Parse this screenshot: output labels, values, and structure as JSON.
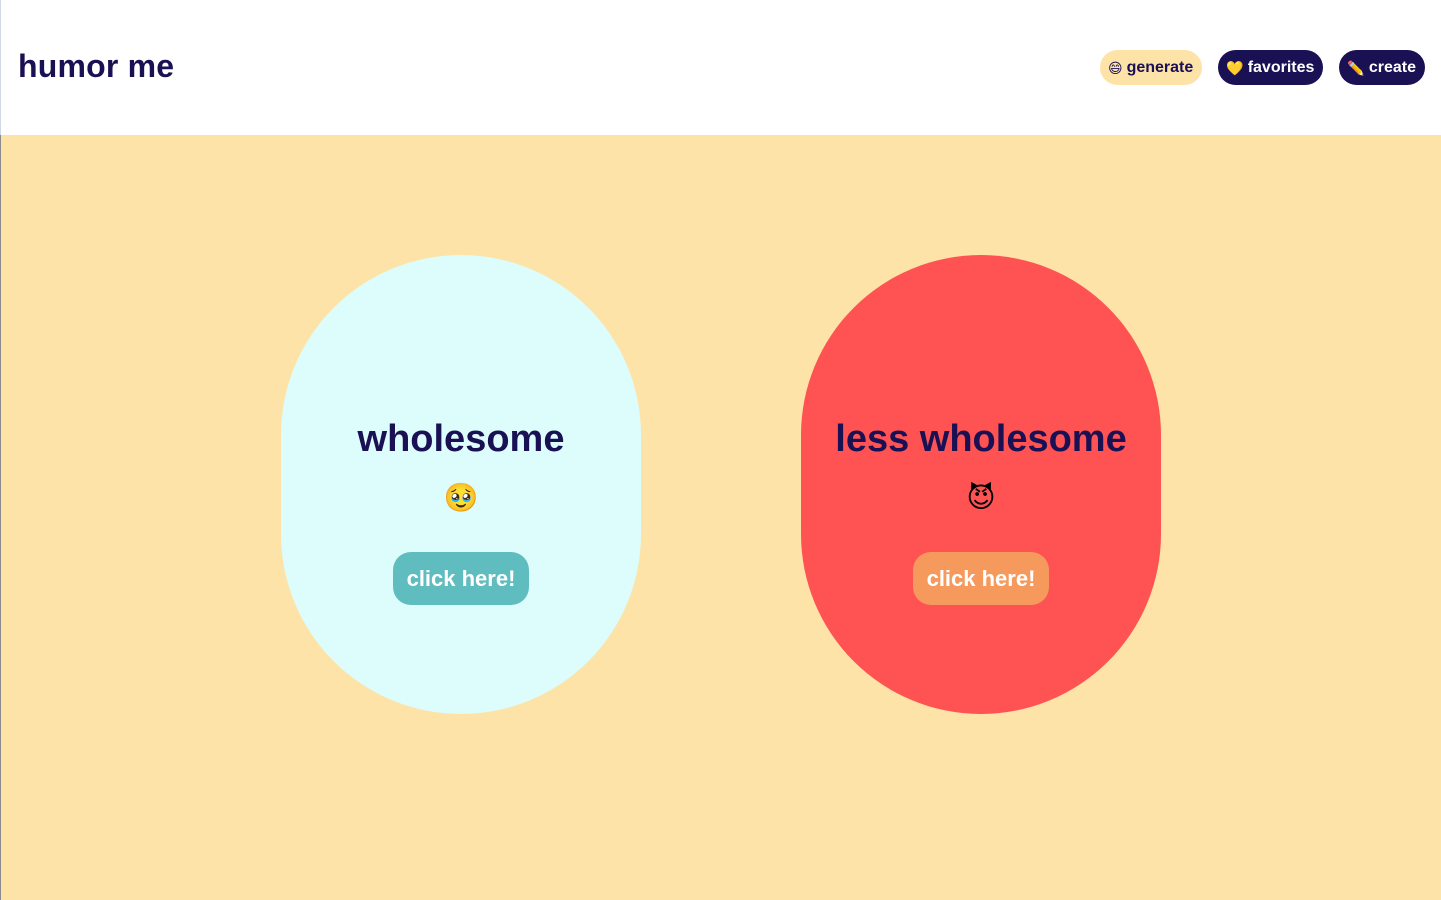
{
  "header": {
    "brand": "humor me",
    "nav": [
      {
        "icon": "😄",
        "icon_name": "grinning-face-icon",
        "label": "generate",
        "active": true
      },
      {
        "icon": "💛",
        "icon_name": "yellow-heart-icon",
        "label": "favorites",
        "active": false
      },
      {
        "icon": "✏️",
        "icon_name": "pencil-icon",
        "label": "create",
        "active": false
      }
    ]
  },
  "cards": [
    {
      "title": "wholesome",
      "emoji": "🥹",
      "emoji_name": "holding-back-tears-face-icon",
      "button_label": "click here!",
      "color": "#dcfdfc",
      "button_color": "#5fbcbf"
    },
    {
      "title": "less wholesome",
      "emoji": "😈",
      "emoji_name": "smiling-devil-face-icon",
      "button_label": "click here!",
      "color": "#fe5352",
      "button_color": "#f59a5c"
    }
  ],
  "colors": {
    "background": "#fde3a7",
    "text": "#1a1054"
  }
}
